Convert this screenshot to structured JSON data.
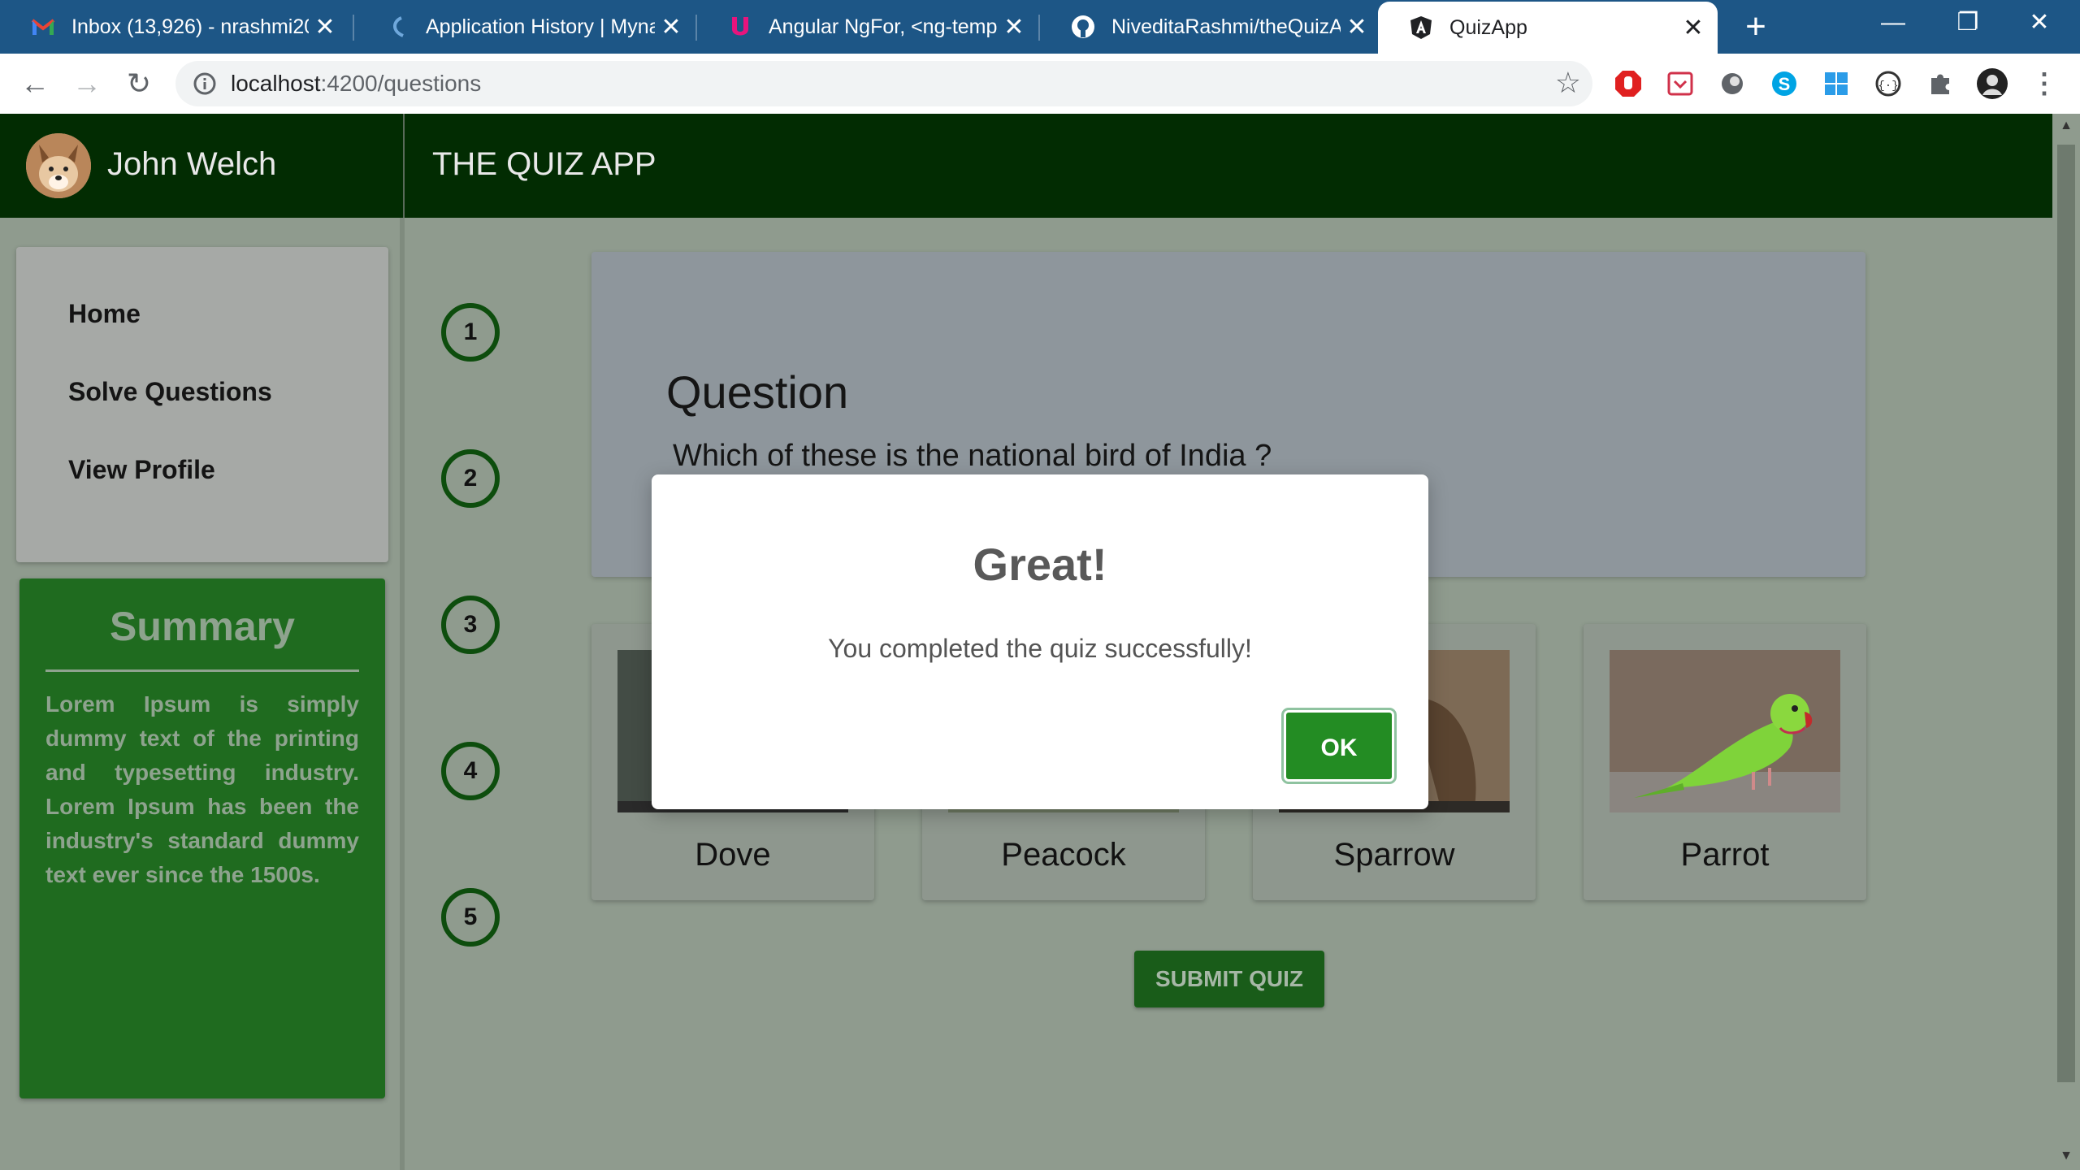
{
  "browser": {
    "tabs": [
      {
        "title": "Inbox (13,926) - nrashmi200",
        "icon": "gmail-icon"
      },
      {
        "title": "Application History | Mynau",
        "icon": "mynau-icon"
      },
      {
        "title": "Angular NgFor, <ng-templa",
        "icon": "ultimate-angular-icon"
      },
      {
        "title": "NiveditaRashmi/theQuizApp",
        "icon": "github-icon"
      },
      {
        "title": "QuizApp",
        "icon": "angular-icon",
        "active": true
      }
    ],
    "new_tab": "+",
    "url_host": "localhost",
    "url_path": ":4200/questions"
  },
  "header": {
    "user_name": "John Welch",
    "app_title": "THE QUIZ APP"
  },
  "sidebar": {
    "nav": [
      {
        "label": "Home"
      },
      {
        "label": "Solve Questions"
      },
      {
        "label": "View Profile"
      }
    ],
    "summary_title": "Summary",
    "summary_text": "Lorem Ipsum is simply dummy text of the printing and typesetting industry. Lorem Ipsum has been the industry's standard dummy text ever since the 1500s."
  },
  "question_numbers": [
    "1",
    "2",
    "3",
    "4",
    "5"
  ],
  "question": {
    "heading": "Question",
    "text": "Which of these is the national bird of India ?"
  },
  "options": [
    {
      "label": "Dove"
    },
    {
      "label": "Peacock"
    },
    {
      "label": "Sparrow"
    },
    {
      "label": "Parrot"
    }
  ],
  "submit_label": "SUBMIT QUIZ",
  "modal": {
    "title": "Great!",
    "text": "You completed the quiz successfully!",
    "ok_label": "OK"
  },
  "colors": {
    "tabbar": "#1d5686",
    "header": "#022c02",
    "summary": "#1f6b1f",
    "ok_button": "#238c23"
  }
}
